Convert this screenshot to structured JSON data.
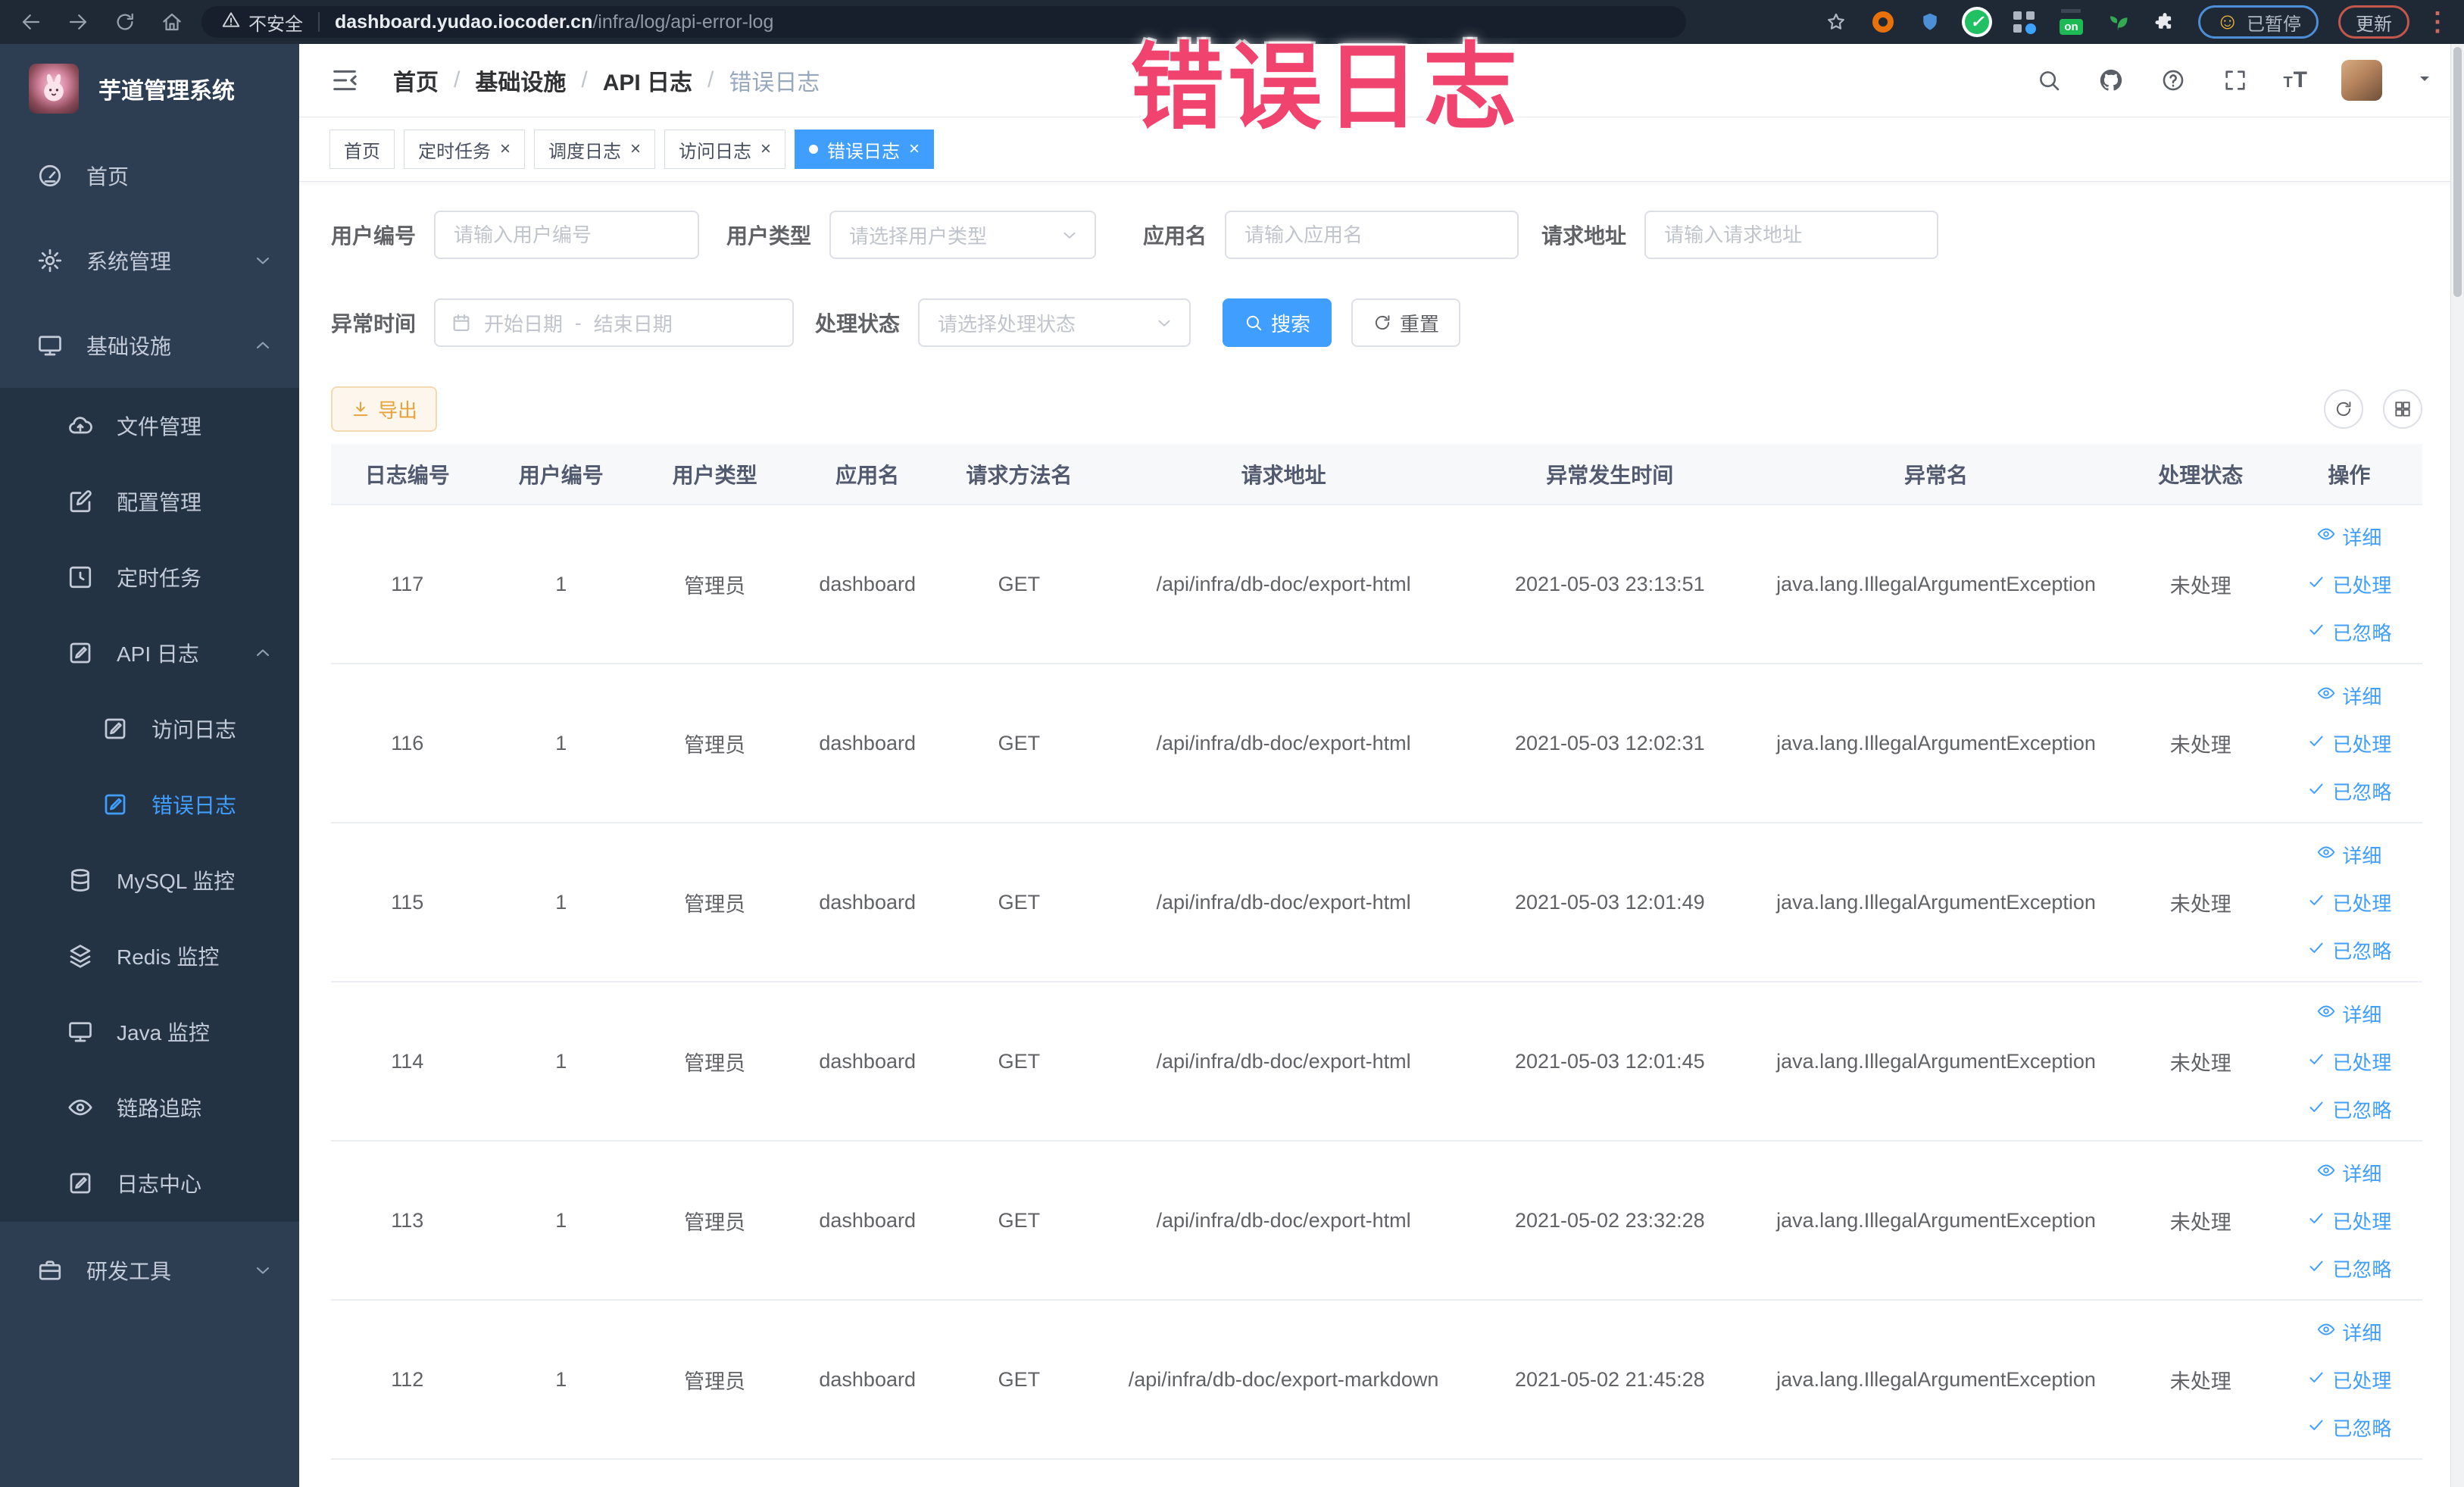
{
  "browser": {
    "nav_icons": [
      "back",
      "forward",
      "reload",
      "home"
    ],
    "security_label": "不安全",
    "url_host": "dashboard.yudao.iocoder.cn",
    "url_path": "/infra/log/api-error-log",
    "extension_icons": [
      "star",
      "target",
      "shield",
      "check-circle",
      "grid-dot",
      "adblock-on",
      "sprout",
      "puzzle"
    ],
    "paused_badge": "已暂停",
    "update_button": "更新"
  },
  "overlay": {
    "text": "错误日志",
    "color": "#f0446e"
  },
  "sidebar": {
    "title": "芋道管理系统",
    "menu": [
      {
        "name": "home",
        "label": "首页",
        "icon": "gauge",
        "level": 1
      },
      {
        "name": "system-management",
        "label": "系统管理",
        "icon": "gear",
        "level": 1,
        "expand": "down"
      },
      {
        "name": "infrastructure",
        "label": "基础设施",
        "icon": "monitor",
        "level": 1,
        "expand": "up"
      },
      {
        "name": "file-management",
        "label": "文件管理",
        "icon": "cloud-up",
        "level": 2
      },
      {
        "name": "config-management",
        "label": "配置管理",
        "icon": "edit-square",
        "level": 2
      },
      {
        "name": "scheduled-jobs",
        "label": "定时任务",
        "icon": "clock-box",
        "level": 2
      },
      {
        "name": "api-log",
        "label": "API 日志",
        "icon": "doc-pen",
        "level": 2,
        "expand": "up"
      },
      {
        "name": "access-log",
        "label": "访问日志",
        "icon": "doc-pen",
        "level": 3
      },
      {
        "name": "error-log",
        "label": "错误日志",
        "icon": "doc-pen",
        "level": 3,
        "active": true
      },
      {
        "name": "mysql-monitor",
        "label": "MySQL 监控",
        "icon": "db",
        "level": 2
      },
      {
        "name": "redis-monitor",
        "label": "Redis 监控",
        "icon": "layers",
        "level": 2
      },
      {
        "name": "java-monitor",
        "label": "Java 监控",
        "icon": "monitor",
        "level": 2
      },
      {
        "name": "trace",
        "label": "链路追踪",
        "icon": "eye",
        "level": 2
      },
      {
        "name": "log-center",
        "label": "日志中心",
        "icon": "doc-pen",
        "level": 2
      },
      {
        "name": "dev-tools",
        "label": "研发工具",
        "icon": "briefcase",
        "level": 1,
        "expand": "down",
        "section": "bottom"
      }
    ]
  },
  "header": {
    "breadcrumb": [
      "首页",
      "基础设施",
      "API 日志",
      "错误日志"
    ],
    "right_icons": [
      "search",
      "github",
      "help",
      "fullscreen",
      "font-size"
    ]
  },
  "tabs": [
    {
      "name": "home",
      "label": "首页",
      "active": false,
      "closable": false
    },
    {
      "name": "job",
      "label": "定时任务",
      "active": false,
      "closable": true
    },
    {
      "name": "job-log",
      "label": "调度日志",
      "active": false,
      "closable": true
    },
    {
      "name": "access-log",
      "label": "访问日志",
      "active": false,
      "closable": true
    },
    {
      "name": "error-log",
      "label": "错误日志",
      "active": true,
      "closable": true
    }
  ],
  "filters": {
    "user_id": {
      "label": "用户编号",
      "placeholder": "请输入用户编号"
    },
    "user_type": {
      "label": "用户类型",
      "placeholder": "请选择用户类型"
    },
    "app_name": {
      "label": "应用名",
      "placeholder": "请输入应用名"
    },
    "request_url": {
      "label": "请求地址",
      "placeholder": "请输入请求地址"
    },
    "exception_time": {
      "label": "异常时间",
      "start_placeholder": "开始日期",
      "separator": "-",
      "end_placeholder": "结束日期"
    },
    "process_status": {
      "label": "处理状态",
      "placeholder": "请选择处理状态"
    },
    "search_button": "搜索",
    "reset_button": "重置"
  },
  "toolbar": {
    "export_button": "导出"
  },
  "table": {
    "columns": [
      {
        "key": "id",
        "label": "日志编号"
      },
      {
        "key": "user_id",
        "label": "用户编号"
      },
      {
        "key": "user_type",
        "label": "用户类型"
      },
      {
        "key": "app_name",
        "label": "应用名"
      },
      {
        "key": "method",
        "label": "请求方法名"
      },
      {
        "key": "url",
        "label": "请求地址"
      },
      {
        "key": "time",
        "label": "异常发生时间"
      },
      {
        "key": "exception",
        "label": "异常名"
      },
      {
        "key": "status",
        "label": "处理状态"
      },
      {
        "key": "actions",
        "label": "操作"
      }
    ],
    "row_actions": [
      {
        "label": "详细",
        "icon": "eye"
      },
      {
        "label": "已处理",
        "icon": "check"
      },
      {
        "label": "已忽略",
        "icon": "check"
      }
    ],
    "rows": [
      {
        "id": "117",
        "user_id": "1",
        "user_type": "管理员",
        "app_name": "dashboard",
        "method": "GET",
        "url": "/api/infra/db-doc/export-html",
        "time": "2021-05-03 23:13:51",
        "exception": "java.lang.IllegalArgumentException",
        "status": "未处理"
      },
      {
        "id": "116",
        "user_id": "1",
        "user_type": "管理员",
        "app_name": "dashboard",
        "method": "GET",
        "url": "/api/infra/db-doc/export-html",
        "time": "2021-05-03 12:02:31",
        "exception": "java.lang.IllegalArgumentException",
        "status": "未处理"
      },
      {
        "id": "115",
        "user_id": "1",
        "user_type": "管理员",
        "app_name": "dashboard",
        "method": "GET",
        "url": "/api/infra/db-doc/export-html",
        "time": "2021-05-03 12:01:49",
        "exception": "java.lang.IllegalArgumentException",
        "status": "未处理"
      },
      {
        "id": "114",
        "user_id": "1",
        "user_type": "管理员",
        "app_name": "dashboard",
        "method": "GET",
        "url": "/api/infra/db-doc/export-html",
        "time": "2021-05-03 12:01:45",
        "exception": "java.lang.IllegalArgumentException",
        "status": "未处理"
      },
      {
        "id": "113",
        "user_id": "1",
        "user_type": "管理员",
        "app_name": "dashboard",
        "method": "GET",
        "url": "/api/infra/db-doc/export-html",
        "time": "2021-05-02 23:32:28",
        "exception": "java.lang.IllegalArgumentException",
        "status": "未处理"
      },
      {
        "id": "112",
        "user_id": "1",
        "user_type": "管理员",
        "app_name": "dashboard",
        "method": "GET",
        "url": "/api/infra/db-doc/export-markdown",
        "time": "2021-05-02 21:45:28",
        "exception": "java.lang.IllegalArgumentException",
        "status": "未处理"
      }
    ]
  },
  "colors": {
    "primary": "#409eff",
    "warning": "#e6a23c",
    "overlay_pink": "#f0446e",
    "sidebar_bg": "#2d3e53",
    "submenu_bg": "#243343"
  }
}
